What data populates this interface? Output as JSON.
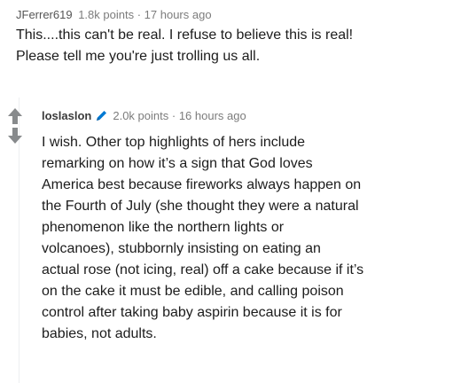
{
  "parent": {
    "username": "JFerrer619",
    "points": "1.8k points",
    "separator": "·",
    "time": "17 hours ago",
    "lines": [
      "This....this can't be real. I refuse to believe this is real!",
      "Please tell me you're just trolling us all."
    ]
  },
  "reply": {
    "username": "loslaslon",
    "user_icon": "pencil-icon",
    "points": "2.0k points",
    "separator": "·",
    "time": "16 hours ago",
    "lines": [
      "I wish. Other top highlights of hers include",
      "remarking on how it’s a sign that God loves",
      "America best because fireworks always happen on",
      "the Fourth of July (she thought they were a natural",
      "phenomenon like the northern lights or",
      "volcanoes), stubbornly insisting on eating an",
      "actual rose (not icing, real) off a cake because if it’s",
      "on the cake it must be edible, and calling poison",
      "control after taking baby aspirin because it is for",
      "babies, not adults."
    ]
  },
  "colors": {
    "text": "#1c1c1c",
    "meta": "#7c7c7c",
    "vote_arrow": "#878a8c",
    "pencil": "#0079d3",
    "thread_line": "#edeff1"
  }
}
